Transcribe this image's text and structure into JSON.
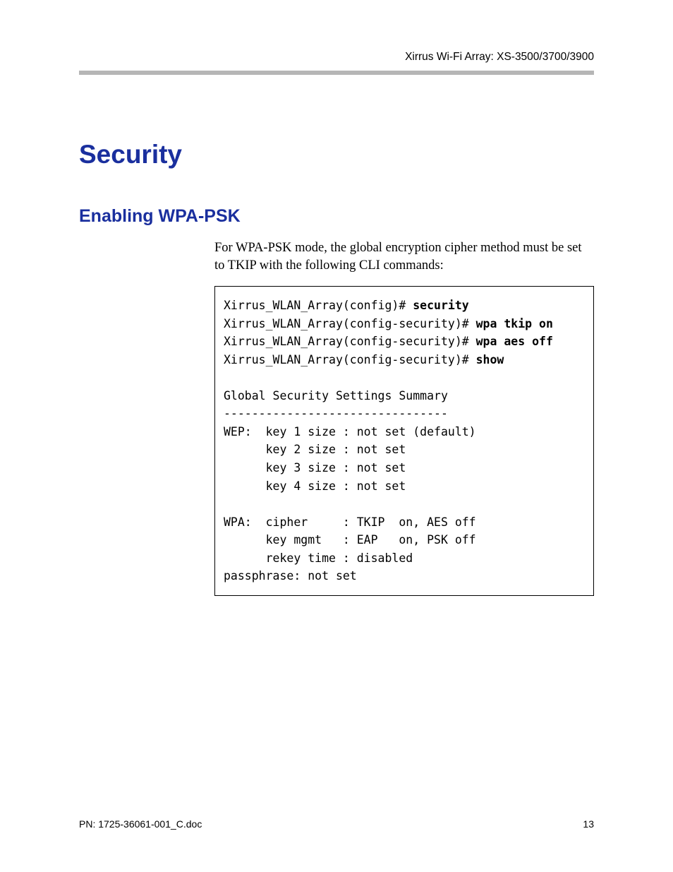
{
  "header": {
    "right": "Xirrus Wi-Fi Array: XS-3500/3700/3900"
  },
  "chapter": {
    "title": "Security"
  },
  "section": {
    "title": "Enabling WPA-PSK",
    "body": "For WPA-PSK mode, the global encryption cipher method must be set to TKIP with the following CLI commands:"
  },
  "cli": {
    "l1_prompt": "Xirrus_WLAN_Array(config)# ",
    "l1_cmd": "security",
    "l2_prompt": "Xirrus_WLAN_Array(config-security)# ",
    "l2_cmd": "wpa tkip on",
    "l3_prompt": "Xirrus_WLAN_Array(config-security)# ",
    "l3_cmd": "wpa aes off",
    "l4_prompt": "Xirrus_WLAN_Array(config-security)# ",
    "l4_cmd": "show",
    "blank1": "",
    "h1": "Global Security Settings Summary",
    "h2": "--------------------------------",
    "w1": "WEP:  key 1 size : not set (default)",
    "w2": "      key 2 size : not set",
    "w3": "      key 3 size : not set",
    "w4": "      key 4 size : not set",
    "blank2": "",
    "p1": "WPA:  cipher     : TKIP  on, AES off",
    "p2": "      key mgmt   : EAP   on, PSK off",
    "p3": "      rekey time : disabled",
    "p4": "passphrase: not set"
  },
  "footer": {
    "left": "PN: 1725-36061-001_C.doc",
    "right": "13"
  }
}
